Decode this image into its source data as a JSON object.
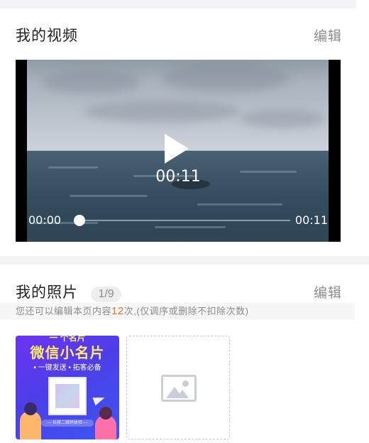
{
  "video_section": {
    "title": "我的视频",
    "edit_label": "编辑",
    "player": {
      "center_time": "00:11",
      "current_time": "00:00",
      "total_time": "00:11",
      "progress": 0.0,
      "play_icon": "play-icon"
    }
  },
  "photo_section": {
    "title": "我的照片",
    "count": "1/9",
    "edit_label": "编辑",
    "notice": {
      "before": "您还可以编辑本页内容",
      "number": "12",
      "after": "次,(仅调序或删除不扣除次数)"
    },
    "photo": {
      "banner_top": "一 个名片",
      "title": "微信小名片",
      "subtitle": "• 一键发送  • 拓客必备",
      "caption": "— 长按二维码体验 —"
    },
    "add_icon": "image-placeholder-icon"
  },
  "colors": {
    "accent_number": "#e0742a",
    "muted_text": "#8c8c8c",
    "section_gap": "#f4f4f6"
  }
}
